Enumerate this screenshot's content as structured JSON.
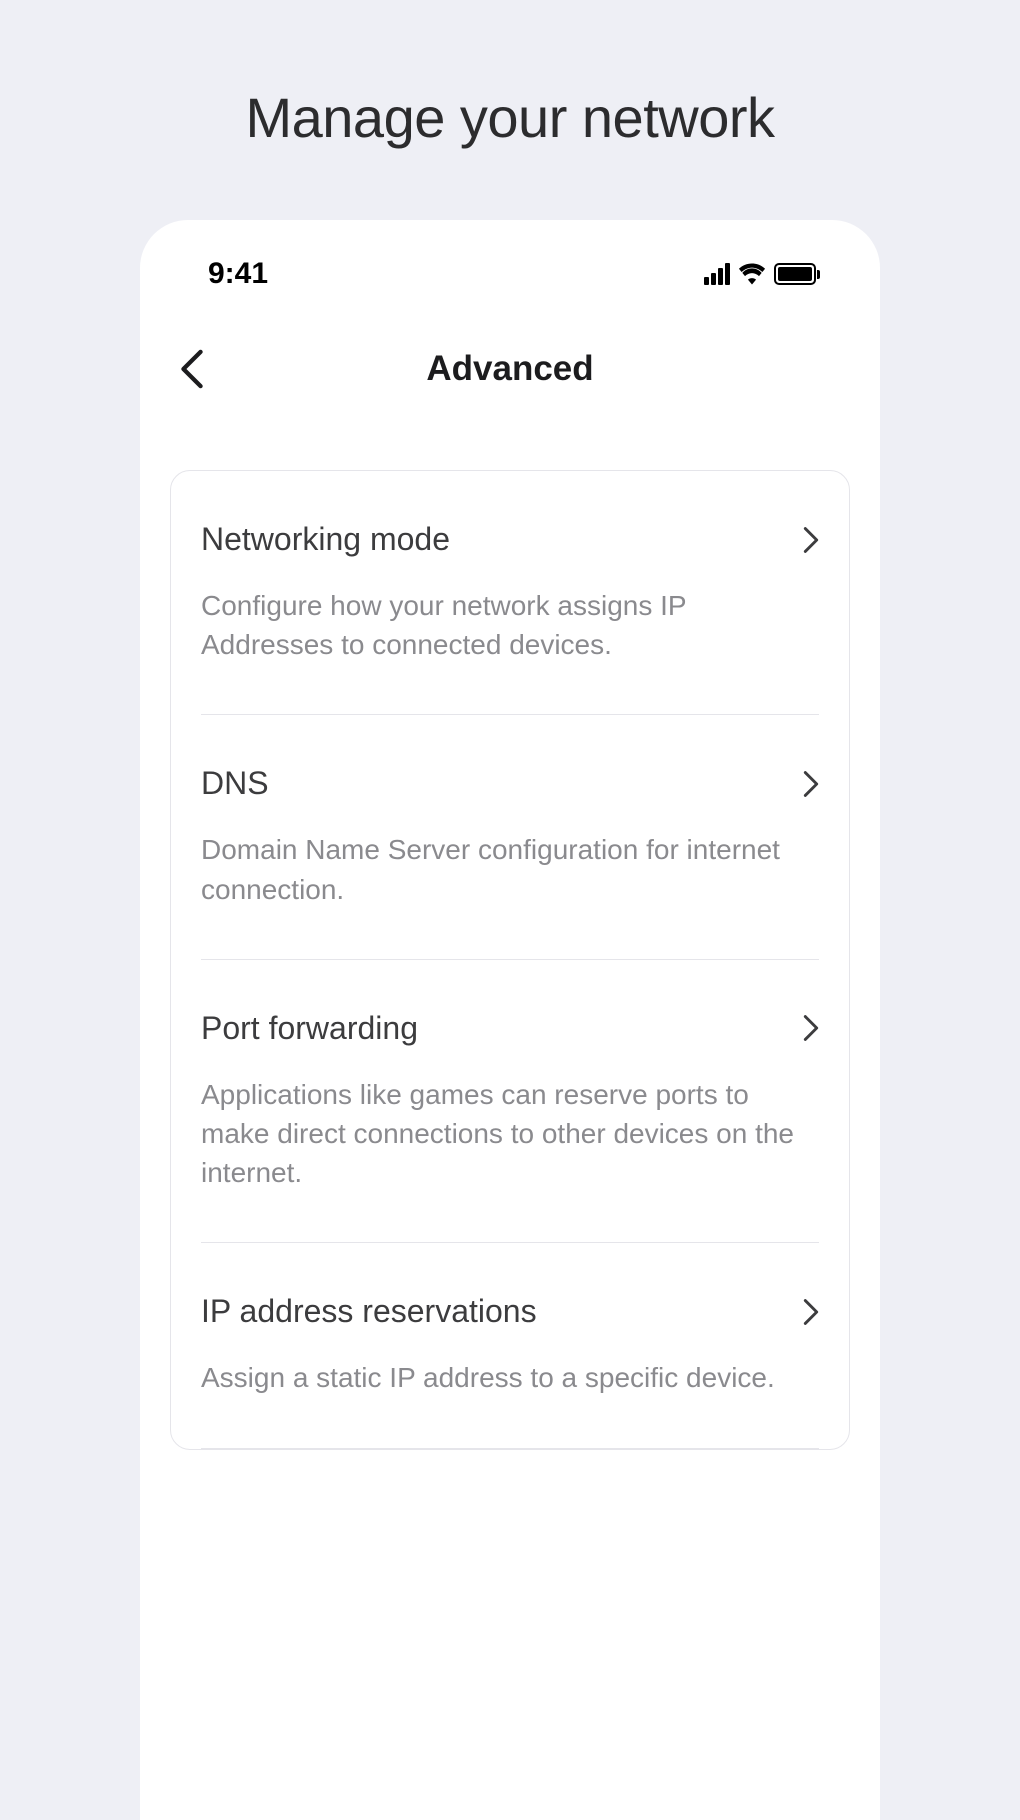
{
  "page": {
    "title": "Manage your network"
  },
  "status": {
    "time": "9:41"
  },
  "nav": {
    "title": "Advanced"
  },
  "settings": {
    "items": [
      {
        "title": "Networking mode",
        "description": "Configure how your network assigns IP Addresses to connected devices."
      },
      {
        "title": "DNS",
        "description": "Domain Name Server configuration for internet connection."
      },
      {
        "title": "Port forwarding",
        "description": "Applications like games can reserve ports to make direct connections to other devices on the internet."
      },
      {
        "title": "IP address reservations",
        "description": "Assign a static IP address to a specific device."
      }
    ]
  }
}
